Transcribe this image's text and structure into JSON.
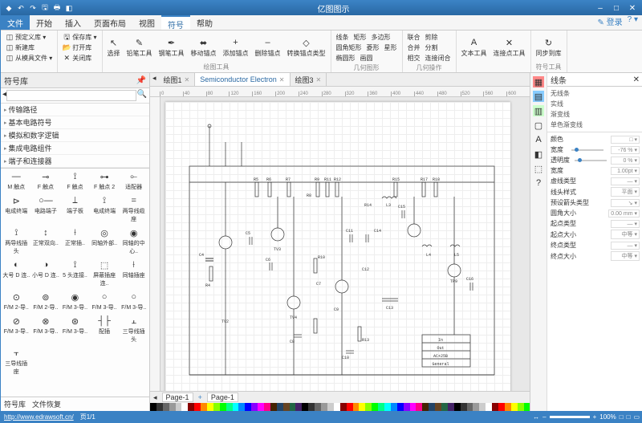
{
  "app": {
    "title": "亿图图示"
  },
  "qat": [
    "↶",
    "↷",
    "🖫",
    "🖶",
    "◧"
  ],
  "winbtns": [
    "–",
    "□",
    "✕"
  ],
  "menu": {
    "tabs": [
      "文件",
      "开始",
      "插入",
      "页面布局",
      "视图",
      "符号",
      "帮助"
    ],
    "active": 5,
    "right": [
      "✎ 登录",
      "? ▾"
    ]
  },
  "ribbon": {
    "g1": {
      "items": [
        [
          "预定义库 ▾",
          "新建库",
          "从模具文件 ▾"
        ],
        [
          "保存库 ▾",
          "打开库",
          "关闭库"
        ]
      ],
      "label": ""
    },
    "g2": {
      "items": [
        "选择",
        "铅笔工具",
        "钢笔工具",
        "移动锚点",
        "添加锚点",
        "删除锚点",
        "转换锚点类型"
      ],
      "label": "绘图工具"
    },
    "g3": {
      "items": [
        [
          "线条",
          "矩形",
          "椭圆形"
        ],
        [
          "圆角矩形",
          "菱形",
          "画圆"
        ],
        [
          "多边形",
          "星形",
          ""
        ]
      ],
      "label": "几何图形"
    },
    "g4": {
      "items": [
        [
          "联合",
          "合并",
          "相交"
        ],
        [
          "剪除",
          "分割",
          "连接闭合"
        ]
      ],
      "label": "几何操作"
    },
    "g5": {
      "items": [
        "文本工具",
        "连接点工具"
      ],
      "label": ""
    },
    "g6": {
      "items": [
        "同步到库"
      ],
      "label": "符号工具"
    }
  },
  "left": {
    "title": "符号库",
    "search_ph": "",
    "categories": [
      "传输路径",
      "基本电路符号",
      "模拟和数字逻辑",
      "集成电路组件",
      "端子和连接器"
    ],
    "shapes": [
      [
        "—",
        "⊸",
        "⟟",
        "⊶",
        "⟜"
      ],
      [
        "M 触点",
        "F 触点",
        "F 触点",
        "F 触点 2",
        "适配器"
      ],
      [
        "⊳",
        "○—",
        "⟘",
        "⟟",
        "="
      ],
      [
        "电成终端",
        "电路端子",
        "端子板",
        "电成终端",
        "两导线缆座"
      ],
      [
        "⟟",
        "↕",
        "⟊",
        "◎",
        "◉"
      ],
      [
        "两导线插头",
        "正常双向..",
        "正常插..",
        "同轴外部..",
        "同轴的中心.."
      ],
      [
        "◐",
        "◑",
        "⟟",
        "⬚",
        "⟊"
      ],
      [
        "大号 D 连..",
        "小号 D 连..",
        "5 头连接..",
        "屏蔽插座连..",
        "同轴插座"
      ],
      [
        "⊙",
        "⊚",
        "◉",
        "○",
        "○"
      ],
      [
        "F/M 2-导..",
        "F/M 2-导..",
        "F/M 3-导..",
        "F/M 3-导..",
        "F/M 3-导.."
      ],
      [
        "⊘",
        "⊗",
        "⊛",
        "┤├",
        "⫠"
      ],
      [
        "F/M 3-导..",
        "F/M 3-导..",
        "F/M 3-导..",
        "配插",
        "三导线插头"
      ],
      [
        "⫟",
        "",
        "",
        "",
        ""
      ],
      [
        "三导线插座",
        "",
        "",
        "",
        ""
      ]
    ],
    "footer": [
      "符号库",
      "文件恢复"
    ]
  },
  "doctabs": [
    {
      "label": "绘图1",
      "active": false
    },
    {
      "label": "Semiconductor Electron",
      "active": true
    },
    {
      "label": "绘图3",
      "active": false
    }
  ],
  "ruler_h": [
    "0",
    "40",
    "80",
    "120",
    "160",
    "200",
    "240",
    "280",
    "320",
    "360",
    "400",
    "440",
    "480",
    "520",
    "560",
    "600"
  ],
  "pagetabs": {
    "pages": [
      "Page-1",
      "Page-1"
    ],
    "plus": "+"
  },
  "swatch_colors": [
    "#000",
    "#333",
    "#666",
    "#999",
    "#ccc",
    "#fff",
    "#800",
    "#f00",
    "#f80",
    "#ff0",
    "#8f0",
    "#0f0",
    "#0f8",
    "#0ff",
    "#08f",
    "#00f",
    "#80f",
    "#f0f",
    "#f08",
    "#420",
    "#246",
    "#642",
    "#264",
    "#426"
  ],
  "right": {
    "title": "线条",
    "style_opts": [
      "无线条",
      "实线",
      "渐变线",
      "单色渐变线"
    ],
    "props": [
      {
        "label": "颜色",
        "type": "color",
        "val": "□"
      },
      {
        "label": "宽度",
        "type": "slider",
        "val": "-76 %"
      },
      {
        "label": "透明度",
        "type": "slider",
        "val": "0 %"
      },
      {
        "label": "宽度",
        "type": "num",
        "val": "1.00pt"
      },
      {
        "label": "虚线类型",
        "type": "sel",
        "val": "—"
      },
      {
        "label": "线头样式",
        "type": "sel",
        "val": "平面"
      },
      {
        "label": "预设箭头类型",
        "type": "sel",
        "val": "↘"
      },
      {
        "label": "圆角大小",
        "type": "num",
        "val": "0.00 mm"
      },
      {
        "label": "起点类型",
        "type": "sel",
        "val": "—"
      },
      {
        "label": "起点大小",
        "type": "sel",
        "val": "中等"
      },
      {
        "label": "终点类型",
        "type": "sel",
        "val": "—"
      },
      {
        "label": "终点大小",
        "type": "sel",
        "val": "中等"
      }
    ],
    "icons": [
      "▦",
      "▤",
      "▥",
      "▢",
      "A",
      "◧",
      "⬚",
      "?"
    ]
  },
  "status": {
    "url": "http://www.edrawsoft.cn/",
    "page": "页1/1",
    "zoom": "100%",
    "right": [
      "↔",
      "—",
      "□",
      "□",
      "▭"
    ]
  },
  "circuit": {
    "labels": [
      "R4",
      "R5",
      "R6",
      "R7",
      "R8",
      "R9",
      "R10",
      "R11",
      "R12",
      "R13",
      "R14",
      "R15",
      "R17",
      "R18",
      "C4",
      "C5",
      "C6",
      "C7",
      "C8",
      "C9",
      "C10",
      "C11",
      "C12",
      "C13",
      "C14",
      "C15",
      "C16",
      "L3",
      "L4",
      "L5",
      "TV3",
      "TV4",
      "TV2",
      "TP9",
      "In",
      "Out",
      "AC+25B",
      "General"
    ]
  }
}
